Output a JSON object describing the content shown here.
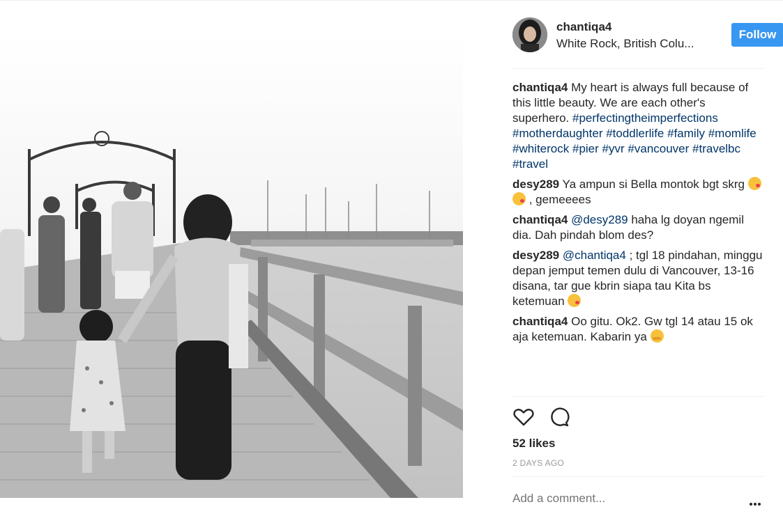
{
  "post": {
    "username": "chantiqa4",
    "location": "White Rock, British Colu...",
    "follow_label": "Follow"
  },
  "comments": [
    {
      "author": "chantiqa4",
      "segments": [
        {
          "type": "text",
          "value": "My heart is always full because of this little beauty. We are each other's superhero. "
        },
        {
          "type": "tag",
          "value": "#perfectingtheimperfections"
        },
        {
          "type": "text",
          "value": " "
        },
        {
          "type": "tag",
          "value": "#motherdaughter"
        },
        {
          "type": "text",
          "value": " "
        },
        {
          "type": "tag",
          "value": "#toddlerlife"
        },
        {
          "type": "text",
          "value": " "
        },
        {
          "type": "tag",
          "value": "#family"
        },
        {
          "type": "text",
          "value": " "
        },
        {
          "type": "tag",
          "value": "#momlife"
        },
        {
          "type": "text",
          "value": " "
        },
        {
          "type": "tag",
          "value": "#whiterock"
        },
        {
          "type": "text",
          "value": " "
        },
        {
          "type": "tag",
          "value": "#pier"
        },
        {
          "type": "text",
          "value": " "
        },
        {
          "type": "tag",
          "value": "#yvr"
        },
        {
          "type": "text",
          "value": " "
        },
        {
          "type": "tag",
          "value": "#vancouver"
        },
        {
          "type": "text",
          "value": " "
        },
        {
          "type": "tag",
          "value": "#travelbc"
        },
        {
          "type": "text",
          "value": " "
        },
        {
          "type": "tag",
          "value": "#travel"
        }
      ]
    },
    {
      "author": "desy289",
      "segments": [
        {
          "type": "text",
          "value": "Ya ampun si Bella montok bgt skrg "
        },
        {
          "type": "emoji",
          "value": "kissing-face-emoji"
        },
        {
          "type": "emoji",
          "value": "kissing-face-emoji"
        },
        {
          "type": "text",
          "value": ", gemeeees"
        }
      ]
    },
    {
      "author": "chantiqa4",
      "segments": [
        {
          "type": "mention",
          "value": "@desy289"
        },
        {
          "type": "text",
          "value": " haha lg doyan ngemil dia. Dah pindah blom des?"
        }
      ]
    },
    {
      "author": "desy289",
      "segments": [
        {
          "type": "mention",
          "value": "@chantiqa4"
        },
        {
          "type": "text",
          "value": " ; tgl 18 pindahan, minggu depan jemput temen dulu di Vancouver, 13-16 disana, tar gue kbrin siapa tau Kita bs ketemuan "
        },
        {
          "type": "emoji",
          "value": "kissing-face-emoji"
        }
      ]
    },
    {
      "author": "chantiqa4",
      "segments": [
        {
          "type": "text",
          "value": "Oo gitu. Ok2. Gw tgl 14 atau 15 ok aja ketemuan. Kabarin ya "
        },
        {
          "type": "emoji",
          "value": "hugging-face-emoji"
        }
      ]
    }
  ],
  "actions": {
    "likes_text": "52 likes",
    "time_text": "2 DAYS AGO",
    "comment_placeholder": "Add a comment..."
  },
  "icons": [
    "heart-icon",
    "comment-icon",
    "more-options-icon"
  ],
  "colors": {
    "link": "#003569",
    "follow_button": "#3897f0",
    "muted": "#999999"
  }
}
